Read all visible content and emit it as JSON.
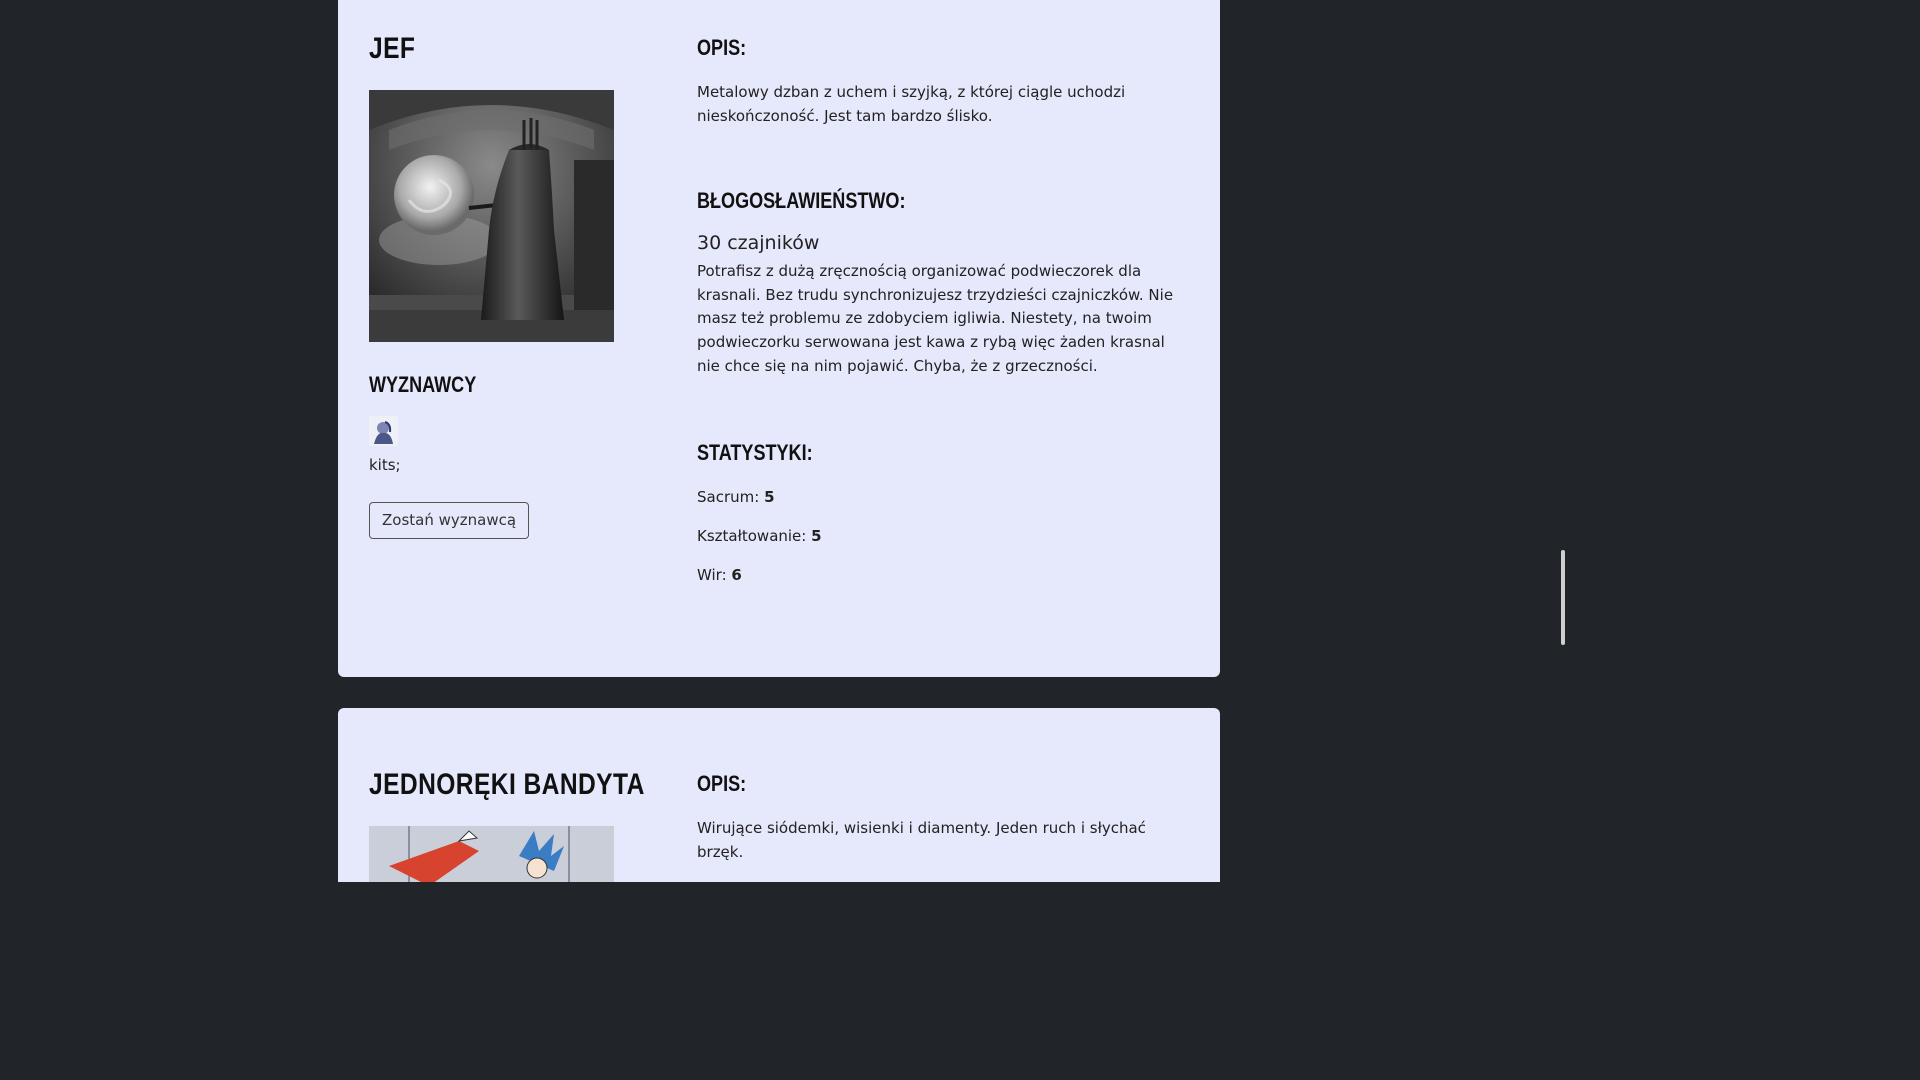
{
  "cards": [
    {
      "name": "JEF",
      "image_icon": "kettle-tower-icon",
      "followers_heading": "WYZNAWCY",
      "followers": [
        "kits;"
      ],
      "follow_button_label": "Zostań wyznawcą",
      "description_heading": "OPIS:",
      "description": "Metalowy dzban z uchem i szyjką, z której ciągle uchodzi nieskończoność. Jest tam bardzo ślisko.",
      "blessing_heading": "BŁOGOSŁAWIEŃSTWO:",
      "blessing_title": "30 czajników",
      "blessing_text": "Potrafisz z dużą zręcznością organizować podwieczorek dla krasnali. Bez trudu synchronizujesz trzydzieści czajniczków. Nie masz też problemu ze zdobyciem igliwia. Niestety, na twoim podwieczorku serwowana jest kawa z rybą więc żaden krasnal nie chce się na nim pojawić. Chyba, że z grzeczności.",
      "stats_heading": "STATYSTYKI:",
      "stats": [
        {
          "label": "Sacrum:",
          "value": "5"
        },
        {
          "label": "Kształtowanie:",
          "value": "5"
        },
        {
          "label": "Wir:",
          "value": "6"
        }
      ]
    },
    {
      "name": "JEDNORĘKI BANDYTA",
      "image_icon": "bandit-illustration-icon",
      "description_heading": "OPIS:",
      "description": "Wirujące siódemki, wisienki i diamenty. Jeden ruch i słychać brzęk."
    }
  ],
  "colors": {
    "background": "#212529",
    "card": "#e6e8fb"
  }
}
